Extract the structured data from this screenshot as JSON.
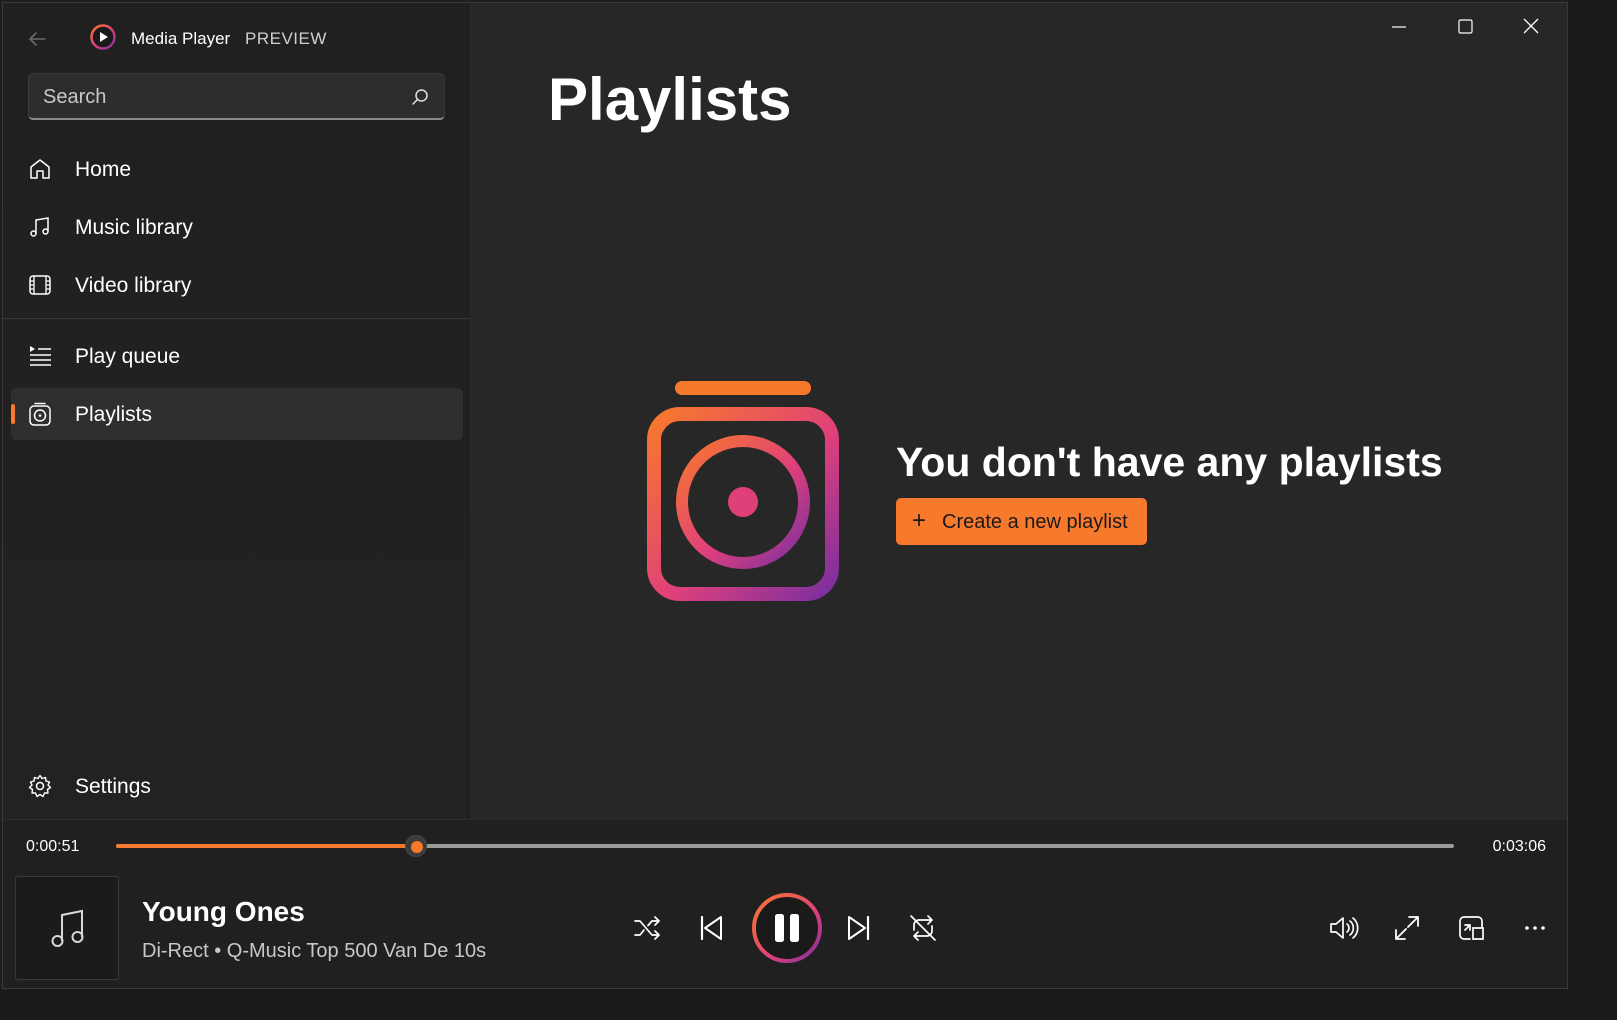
{
  "app": {
    "title": "Media Player",
    "badge": "PREVIEW"
  },
  "search": {
    "placeholder": "Search"
  },
  "nav": {
    "home": "Home",
    "music_library": "Music library",
    "video_library": "Video library",
    "play_queue": "Play queue",
    "playlists": "Playlists",
    "settings": "Settings",
    "active": "playlists"
  },
  "main": {
    "page_title": "Playlists",
    "empty_message": "You don't have any playlists",
    "create_button": "Create a new playlist",
    "create_plus": "+"
  },
  "player": {
    "current_time": "0:00:51",
    "total_time": "0:03:06",
    "progress_fraction": 0.224,
    "track_title": "Young Ones",
    "track_subtitle": "Di-Rect • Q-Music Top 500 Van De 10s",
    "state": "playing"
  },
  "colors": {
    "accent": "#f7792b",
    "gradient_start": "#f7792b",
    "gradient_mid": "#e0407a",
    "gradient_end": "#7a2fa0"
  },
  "icons": {
    "back": "arrow-left",
    "logo": "play-circle",
    "search": "magnifier",
    "home": "house",
    "music": "music-note",
    "video": "film",
    "queue": "list",
    "playlists": "playlist-speaker",
    "settings": "gear",
    "shuffle": "shuffle",
    "previous": "skip-previous",
    "pause": "pause",
    "next": "skip-next",
    "repeat": "repeat",
    "volume": "speaker",
    "fullscreen": "expand",
    "miniplayer": "mini-player",
    "more": "ellipsis"
  }
}
